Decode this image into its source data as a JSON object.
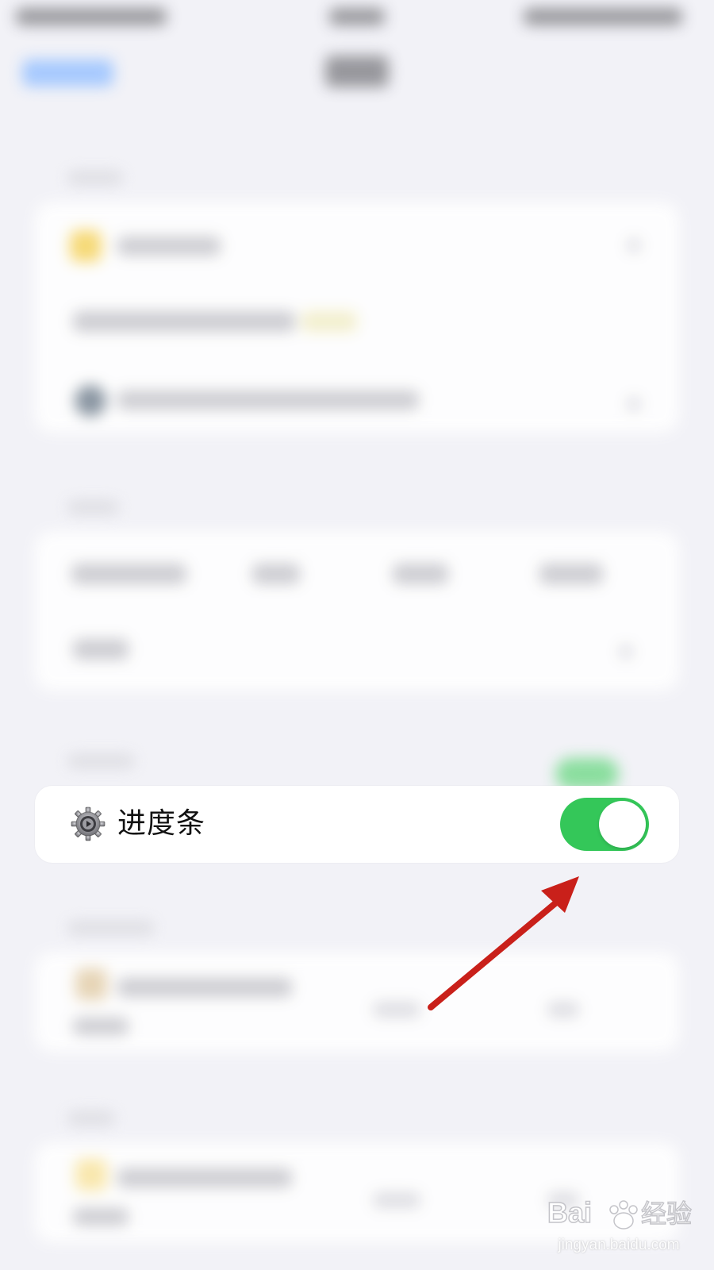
{
  "row": {
    "label": "进度条",
    "icon": "gear-icon",
    "toggle_on": true
  },
  "colors": {
    "background": "#f2f2f7",
    "toggle_on": "#34c759",
    "arrow": "#c9201a"
  },
  "watermark": {
    "brand": "Bai 经验",
    "url": "jingyan.baidu.com"
  }
}
